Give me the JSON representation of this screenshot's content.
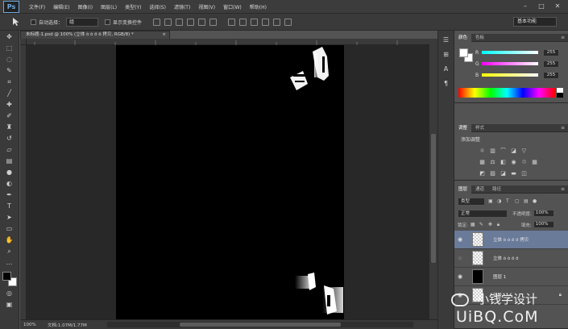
{
  "app": {
    "logo": "Ps"
  },
  "menu": [
    "文件(F)",
    "编辑(E)",
    "图像(I)",
    "图层(L)",
    "类型(Y)",
    "选择(S)",
    "滤镜(T)",
    "视图(V)",
    "窗口(W)",
    "帮助(H)"
  ],
  "window_controls": {
    "minimize": "–",
    "maximize": "□",
    "close": "✕"
  },
  "options": {
    "auto_select_label": "自动选择：",
    "auto_select_value": "组",
    "show_transform_label": "显示变换控件",
    "workspace": "基本功能"
  },
  "document": {
    "tab_title": "未标题-1.psd @ 100% (立体 ò  ò  ö  ö 拷贝, RGB/8) *",
    "tab_close": "×"
  },
  "status": {
    "zoom": "100%",
    "doc_info": "文档:1.07M/1.77M"
  },
  "color_panel": {
    "tabs": [
      "颜色",
      "色板"
    ],
    "sliders": [
      {
        "label": "R",
        "value": "255",
        "gradient": "linear-gradient(90deg, #00ffff, #ffffff)"
      },
      {
        "label": "G",
        "value": "255",
        "gradient": "linear-gradient(90deg, #ff00ff, #ffffff)"
      },
      {
        "label": "B",
        "value": "255",
        "gradient": "linear-gradient(90deg, #ffff00, #ffffff)"
      }
    ]
  },
  "adjustments_panel": {
    "tabs": [
      "调整",
      "样式"
    ],
    "title": "添加调整"
  },
  "layers_panel": {
    "tabs": [
      "图层",
      "通道",
      "路径"
    ],
    "filter_kind": "类型",
    "blend_mode": "正常",
    "opacity_label": "不透明度:",
    "opacity_value": "100%",
    "lock_label": "锁定:",
    "fill_label": "填充:",
    "fill_value": "100%",
    "layers": [
      {
        "name": "立体 ò  ò  ö  ö 拷贝",
        "visible": true,
        "selected": true,
        "thumb": "checker",
        "locked": false
      },
      {
        "name": "立体 ò  ò  ö  ö",
        "visible": false,
        "selected": false,
        "thumb": "checker",
        "locked": false
      },
      {
        "name": "图层 1",
        "visible": true,
        "selected": false,
        "thumb": "black",
        "locked": false
      },
      {
        "name": "背景",
        "visible": true,
        "selected": false,
        "thumb": "checker",
        "locked": true
      }
    ]
  },
  "watermark": {
    "line1": "小钱学设计",
    "line2": "UiBQ.CoM"
  }
}
